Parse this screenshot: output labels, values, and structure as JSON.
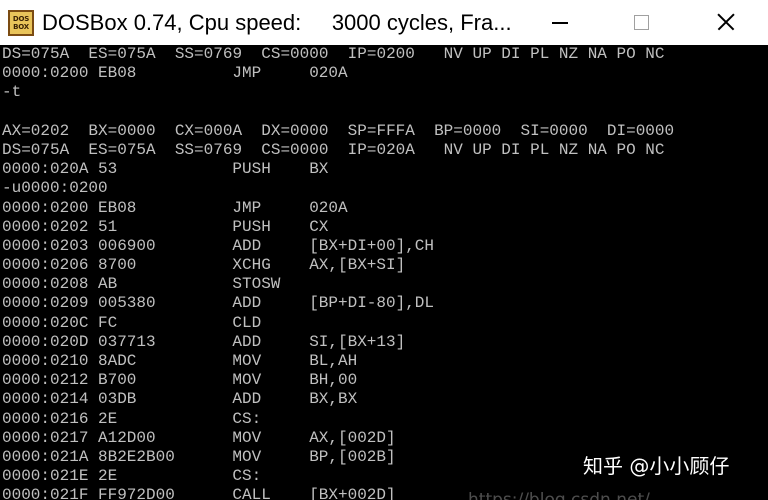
{
  "window": {
    "title": "DOSBox 0.74, Cpu speed:     3000 cycles, Fra...",
    "app_icon": {
      "name": "dosbox-icon",
      "text_top": "DOS",
      "text_bottom": "BOX"
    },
    "controls": {
      "minimize": "minimize-icon",
      "maximize": "maximize-icon",
      "close": "close-icon"
    },
    "colors": {
      "title_bar": "#ffffff",
      "title_text": "#000000"
    }
  },
  "console": {
    "colors": {
      "background": "#000000",
      "text": "#c0c0c0"
    },
    "lines": [
      "DS=075A  ES=075A  SS=0769  CS=0000  IP=0200   NV UP DI PL NZ NA PO NC",
      {
        "address": "0000:0200",
        "bytes": "EB08",
        "mnemonic": "JMP",
        "operands": "020A"
      },
      "-t",
      "",
      "AX=0202  BX=0000  CX=000A  DX=0000  SP=FFFA  BP=0000  SI=0000  DI=0000",
      "DS=075A  ES=075A  SS=0769  CS=0000  IP=020A   NV UP DI PL NZ NA PO NC",
      {
        "address": "0000:020A",
        "bytes": "53",
        "mnemonic": "PUSH",
        "operands": "BX"
      },
      "-u0000:0200",
      {
        "address": "0000:0200",
        "bytes": "EB08",
        "mnemonic": "JMP",
        "operands": "020A"
      },
      {
        "address": "0000:0202",
        "bytes": "51",
        "mnemonic": "PUSH",
        "operands": "CX"
      },
      {
        "address": "0000:0203",
        "bytes": "006900",
        "mnemonic": "ADD",
        "operands": "[BX+DI+00],CH"
      },
      {
        "address": "0000:0206",
        "bytes": "8700",
        "mnemonic": "XCHG",
        "operands": "AX,[BX+SI]"
      },
      {
        "address": "0000:0208",
        "bytes": "AB",
        "mnemonic": "STOSW"
      },
      {
        "address": "0000:0209",
        "bytes": "005380",
        "mnemonic": "ADD",
        "operands": "[BP+DI-80],DL"
      },
      {
        "address": "0000:020C",
        "bytes": "FC",
        "mnemonic": "CLD"
      },
      {
        "address": "0000:020D",
        "bytes": "037713",
        "mnemonic": "ADD",
        "operands": "SI,[BX+13]"
      },
      {
        "address": "0000:0210",
        "bytes": "8ADC",
        "mnemonic": "MOV",
        "operands": "BL,AH"
      },
      {
        "address": "0000:0212",
        "bytes": "B700",
        "mnemonic": "MOV",
        "operands": "BH,00"
      },
      {
        "address": "0000:0214",
        "bytes": "03DB",
        "mnemonic": "ADD",
        "operands": "BX,BX"
      },
      {
        "address": "0000:0216",
        "bytes": "2E",
        "mnemonic": "CS:"
      },
      {
        "address": "0000:0217",
        "bytes": "A12D00",
        "mnemonic": "MOV",
        "operands": "AX,[002D]"
      },
      {
        "address": "0000:021A",
        "bytes": "8B2E2B00",
        "mnemonic": "MOV",
        "operands": "BP,[002B]"
      },
      {
        "address": "0000:021E",
        "bytes": "2E",
        "mnemonic": "CS:"
      },
      {
        "address": "0000:021F",
        "bytes": "FF972D00",
        "mnemonic": "CALL",
        "operands": "[BX+002D]"
      }
    ]
  },
  "watermarks": {
    "zhihu": "知乎 @小小顾仔",
    "csdn": "https://blog.csdn.net/"
  }
}
